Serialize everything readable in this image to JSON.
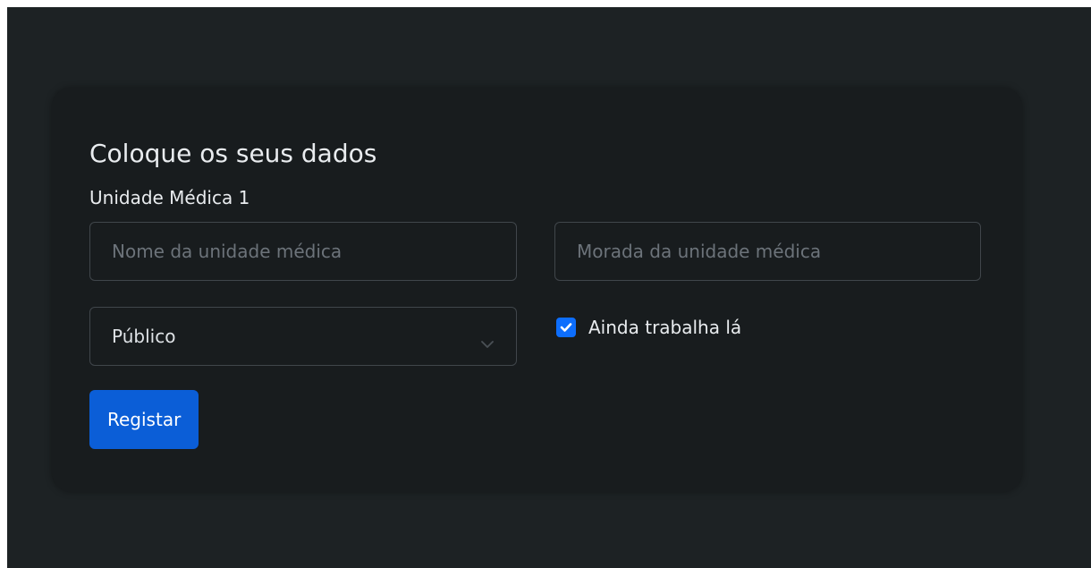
{
  "form": {
    "title": "Coloque os seus dados",
    "section_label": "Unidade Médica 1",
    "name_placeholder": "Nome da unidade médica",
    "name_value": "",
    "address_placeholder": "Morada da unidade médica",
    "address_value": "",
    "sector_selected": "Público",
    "still_works_label": "Ainda trabalha lá",
    "still_works_checked": true,
    "submit_label": "Registar"
  },
  "icons": {
    "select_indicator": "chevron-down-icon",
    "checkbox_mark": "checkmark-icon"
  },
  "colors": {
    "page_background": "#1d2224",
    "card_background": "#181c1e",
    "accent": "#0d6efd",
    "button": "#0b5ed7",
    "border": "#40464b",
    "text": "#e9ecef",
    "placeholder": "#6c737a"
  }
}
